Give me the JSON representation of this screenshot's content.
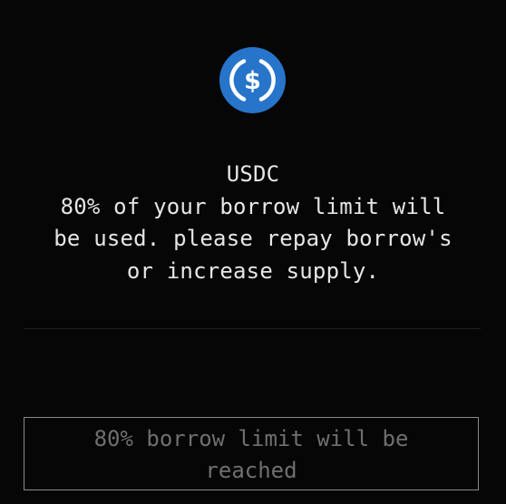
{
  "token": {
    "icon": "usdc-coin-icon",
    "icon_color": "#2775CA",
    "symbol": "USDC"
  },
  "warning": {
    "line1": "80% of your borrow limit will",
    "line2": "be used. please repay borrow's",
    "line3": "or increase supply."
  },
  "action": {
    "label": "80% borrow limit will be reached",
    "disabled": true
  }
}
